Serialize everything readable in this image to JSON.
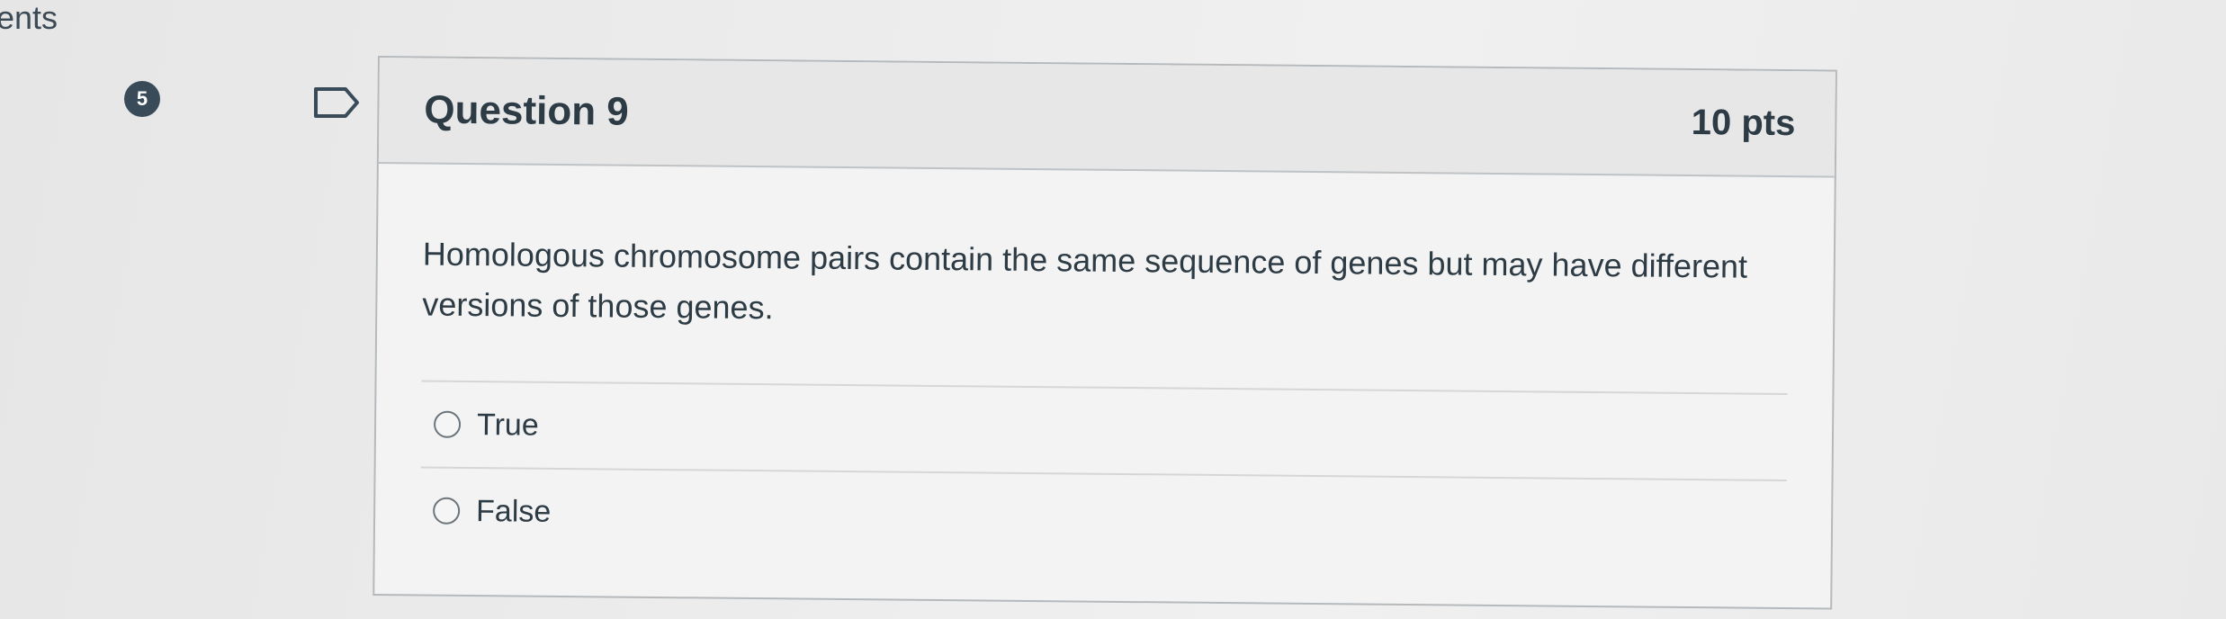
{
  "page": {
    "partial_heading": "ents"
  },
  "sidebar": {
    "badge_count": "5"
  },
  "question": {
    "title": "Question 9",
    "points": "10 pts",
    "text": "Homologous chromosome pairs contain the same sequence of genes but may have different versions of those genes.",
    "answers": [
      {
        "label": "True"
      },
      {
        "label": "False"
      }
    ]
  },
  "icons": {
    "flag": "flag-question-icon",
    "radio": "radio-unselected-icon"
  },
  "colors": {
    "badge_bg": "#394b58",
    "text": "#2d3b45",
    "header_bg": "#e7e7e7",
    "border": "#b5b9bc"
  }
}
